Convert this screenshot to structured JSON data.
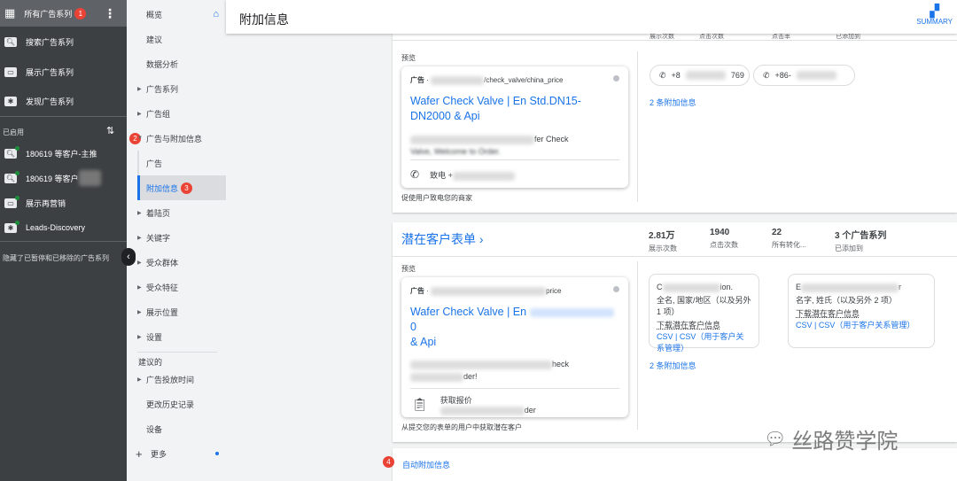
{
  "sidebar": {
    "all_campaigns": "所有广告系列",
    "badge1": "1",
    "types": [
      {
        "icon": "search-icon",
        "label": "搜索广告系列"
      },
      {
        "icon": "display-icon",
        "label": "展示广告系列"
      },
      {
        "icon": "discovery-icon",
        "label": "发现广告系列"
      }
    ],
    "enabled_label": "已启用",
    "campaigns": [
      {
        "icon": "search-icon",
        "label": "180619 等客户-主推"
      },
      {
        "icon": "search-icon",
        "label": "180619 等客户"
      },
      {
        "icon": "display-icon",
        "label": "展示再营销"
      },
      {
        "icon": "discovery-icon",
        "label": "Leads-Discovery"
      }
    ],
    "hidden_note": "隐藏了已暂停和已移除的广告系列"
  },
  "nav": {
    "items": [
      "概览",
      "建议",
      "数据分析",
      "广告系列",
      "广告组",
      "广告与附加信息",
      "广告",
      "附加信息",
      "着陆页",
      "关键字",
      "受众群体",
      "受众特征",
      "展示位置",
      "设置"
    ],
    "suggested": "建议的",
    "more_items": [
      "广告投放时间",
      "更改历史记录",
      "设备"
    ],
    "more": "更多",
    "badge2": "2",
    "badge3": "3"
  },
  "header": {
    "title": "附加信息",
    "summary": "SUMMARY"
  },
  "card1": {
    "stat_labels": [
      "展示次数",
      "点击次数",
      "点击率",
      "已添加到"
    ],
    "preview": "预览",
    "ad_label": "广告",
    "url": "/check_valve/china_price",
    "headline": "Wafer Check Valve | En Std.DN15-DN2000 & Api",
    "desc1": "fer Check",
    "desc2": "Valve, Welcome to Order.",
    "call": "致电 +",
    "caption": "促使用户致电您的商家",
    "phones": [
      "+8",
      "769",
      "+86-"
    ],
    "more_link": "2 条附加信息"
  },
  "card2": {
    "title": "潜在客户表单",
    "stats": [
      {
        "value": "2.81万",
        "label": "展示次数"
      },
      {
        "value": "1940",
        "label": "点击次数"
      },
      {
        "value": "22",
        "label": "所有转化..."
      },
      {
        "value": "3 个广告系列",
        "label": "已添加到"
      }
    ],
    "preview": "预览",
    "ad_label": "广告",
    "url": "price",
    "headline": "Wafer Check Valve | En",
    "headline_end": "0",
    "headline2": "& Api",
    "desc1": "heck",
    "desc2": "der!",
    "form_cta": "获取报价",
    "form_sub": "der",
    "caption": "从提交您的表单的用户中获取潜在客户",
    "forms": [
      {
        "name_start": "C",
        "name_end": "ion.",
        "fields": "全名, 国家/地区（以及另外 1 项）",
        "download": "下载潜在客户信息",
        "links": "CSV | CSV（用于客户关系管理）"
      },
      {
        "name_start": "E",
        "name_end": "r",
        "fields": "名字, 姓氏（以及另外 2 项）",
        "download": "下载潜在客户信息",
        "links": "CSV | CSV（用于客户关系管理）"
      }
    ],
    "more_link": "2 条附加信息"
  },
  "card3": {
    "link": "自动附加信息",
    "badge4": "4"
  },
  "watermark": "丝路赞学院",
  "colors": {
    "accent": "#1a73e8",
    "sidebar": "#3c4043",
    "badge": "#ea4335"
  }
}
